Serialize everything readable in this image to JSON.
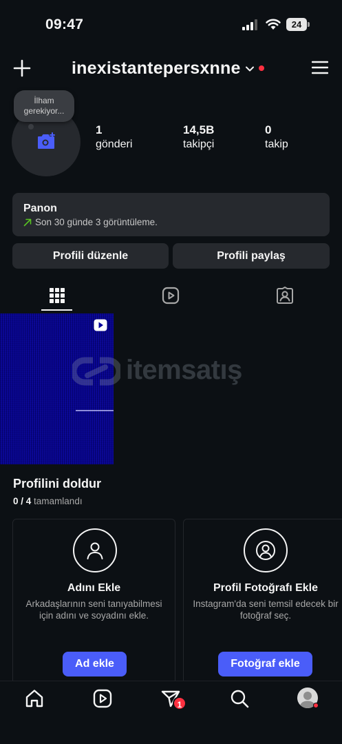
{
  "status_bar": {
    "time": "09:47",
    "battery": "24"
  },
  "header": {
    "username": "inexistantepersxnne"
  },
  "note": {
    "text_line1": "İlham",
    "text_line2": "gerekiyor..."
  },
  "stats": [
    {
      "value": "1",
      "label": "gönderi"
    },
    {
      "value": "14,5B",
      "label": "takipçi"
    },
    {
      "value": "0",
      "label": "takip"
    }
  ],
  "dashboard": {
    "title": "Panon",
    "subtitle": "Son 30 günde 3 görüntüleme."
  },
  "buttons": {
    "edit_profile": "Profili düzenle",
    "share_profile": "Profili paylaş"
  },
  "watermark": {
    "text": "itemsatış"
  },
  "complete_profile": {
    "title": "Profilini doldur",
    "progress": "0 / 4",
    "progress_label": "tamamlandı",
    "cards": [
      {
        "title": "Adını Ekle",
        "description": "Arkadaşlarının seni tanıyabilmesi için adını ve soyadını ekle.",
        "button": "Ad ekle"
      },
      {
        "title": "Profil Fotoğrafı Ekle",
        "description": "Instagram'da seni temsil edecek bir fotoğraf seç.",
        "button": "Fotoğraf ekle"
      }
    ]
  },
  "bottom_nav": {
    "activity_badge": "1"
  },
  "colors": {
    "background": "#0c1014",
    "accent": "#4a5df9",
    "notification": "#ff3040",
    "surface": "#26292e"
  }
}
